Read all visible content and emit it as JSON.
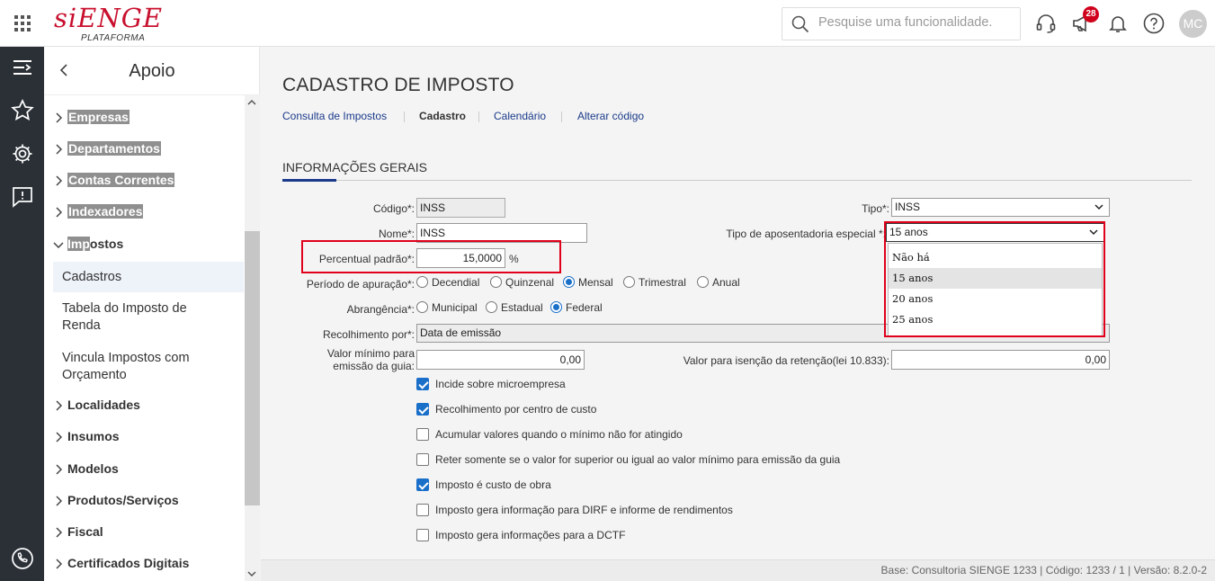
{
  "header": {
    "logo": "siENGE",
    "logo_sub": "PLATAFORMA",
    "search_placeholder": "Pesquise uma funcionalidade.",
    "notifications_count": "28",
    "avatar_initials": "MC"
  },
  "sidebar": {
    "title": "Apoio",
    "items": [
      {
        "label": "Empresas"
      },
      {
        "label": "Departamentos"
      },
      {
        "label": "Contas Correntes"
      },
      {
        "label": "Indexadores"
      },
      {
        "label_hl": "Imp",
        "label_rest": "ostos"
      },
      {
        "label": "Localidades"
      },
      {
        "label": "Insumos"
      },
      {
        "label": "Modelos"
      },
      {
        "label": "Produtos/Serviços"
      },
      {
        "label": "Fiscal"
      },
      {
        "label": "Certificados Digitais"
      }
    ],
    "subitems": [
      {
        "label": "Cadastros"
      },
      {
        "label": "Tabela do Imposto de Renda"
      },
      {
        "label": "Vincula Impostos com Orçamento"
      }
    ]
  },
  "main": {
    "title": "CADASTRO DE IMPOSTO",
    "tabs": [
      {
        "label": "Consulta de Impostos"
      },
      {
        "label": "Cadastro"
      },
      {
        "label": "Calendário"
      },
      {
        "label": "Alterar código"
      }
    ],
    "section": "INFORMAÇÕES GERAIS",
    "form": {
      "codigo_label": "Código*:",
      "codigo_value": "INSS",
      "nome_label": "Nome*:",
      "nome_value": "INSS",
      "percentual_label": "Percentual padrão*:",
      "percentual_value": "15,0000",
      "percentual_unit": "%",
      "periodo_label": "Período de apuração*:",
      "periodo_options": [
        "Decendial",
        "Quinzenal",
        "Mensal",
        "Trimestral",
        "Anual"
      ],
      "periodo_selected": "Mensal",
      "abrangencia_label": "Abrangência*:",
      "abrangencia_options": [
        "Municipal",
        "Estadual",
        "Federal"
      ],
      "abrangencia_selected": "Federal",
      "recolhimento_label": "Recolhimento por*:",
      "recolhimento_value": "Data de emissão",
      "valor_minimo_label_1": "Valor mínimo para",
      "valor_minimo_label_2": "emissão da guia:",
      "valor_minimo_value": "0,00",
      "tipo_label": "Tipo*:",
      "tipo_value": "INSS",
      "tipo_apos_label": "Tipo de aposentadoria especial *:",
      "tipo_apos_value": "15 anos",
      "tipo_apos_options": [
        "Não há",
        "15 anos",
        "20 anos",
        "25 anos"
      ],
      "isencao_label": "Valor para isenção da retenção(lei 10.833):",
      "isencao_value": "0,00",
      "checkboxes": [
        {
          "label": "Incide sobre microempresa",
          "checked": true
        },
        {
          "label": "Recolhimento por centro de custo",
          "checked": true
        },
        {
          "label": "Acumular valores quando o mínimo não for atingido",
          "checked": false
        },
        {
          "label": "Reter somente se o valor for superior ou igual ao valor mínimo para emissão da guia",
          "checked": false
        },
        {
          "label": "Imposto é custo de obra",
          "checked": true
        },
        {
          "label": "Imposto gera informação para DIRF e informe de rendimentos",
          "checked": false
        },
        {
          "label": "Imposto gera informações para a DCTF",
          "checked": false
        }
      ]
    }
  },
  "footer": {
    "text": "Base: Consultoria SIENGE 1233 | Código: 1233 / 1 | Versão: 8.2.0-2"
  },
  "colors": {
    "brand": "#c8102e",
    "accent": "#1a6fc9",
    "highlight_box": "#e0001b"
  }
}
